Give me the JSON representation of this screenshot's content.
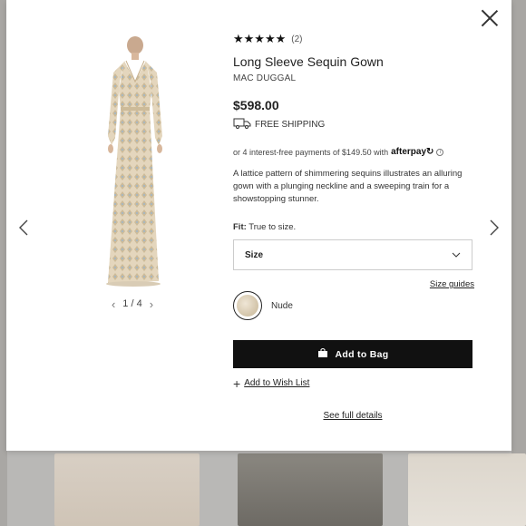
{
  "product": {
    "stars": "★★★★★",
    "review_count": "(2)",
    "title": "Long Sleeve Sequin Gown",
    "brand": "MAC DUGGAL",
    "price": "$598.00",
    "shipping": "FREE SHIPPING",
    "afterpay_text": "or 4 interest-free payments of $149.50 with",
    "afterpay_brand": "afterpay",
    "description": "A lattice pattern of shimmering sequins illustrates an alluring gown with a plunging neckline and a sweeping train for a showstopping stunner.",
    "fit_label": "Fit:",
    "fit_value": "True to size.",
    "size_placeholder": "Size",
    "size_guides": "Size guides",
    "color_name": "Nude",
    "add_to_bag": "Add to Bag",
    "wishlist": "Add to Wish List",
    "full_details": "See full details"
  },
  "gallery": {
    "pager": "1 / 4"
  },
  "colors": {
    "accent": "#111111",
    "gown": "#e2d4bb"
  },
  "icons": {
    "close": "close-icon",
    "prev": "chevron-left-icon",
    "next": "chevron-right-icon",
    "truck": "truck-icon",
    "bag": "bag-icon",
    "chevron_down": "chevron-down-icon",
    "plus": "plus-icon",
    "info": "info-icon"
  }
}
